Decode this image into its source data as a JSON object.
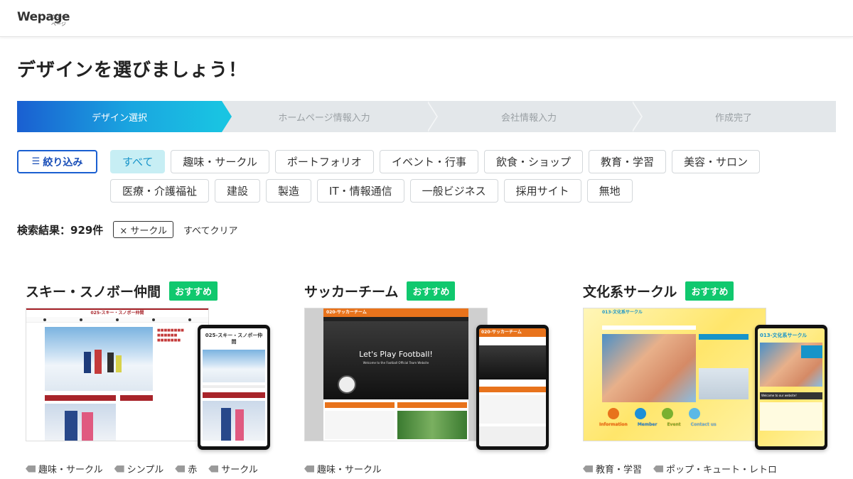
{
  "header": {
    "logo": "Wepage",
    "logo_ruby": "ウィーページ"
  },
  "page_title": "デザインを選びましょう！",
  "steps": [
    {
      "label": "デザイン選択",
      "active": true
    },
    {
      "label": "ホームページ情報入力",
      "active": false
    },
    {
      "label": "会社情報入力",
      "active": false
    },
    {
      "label": "作成完了",
      "active": false
    }
  ],
  "filter": {
    "label": "絞り込み",
    "icon": "filter-search-icon"
  },
  "chips": [
    {
      "label": "すべて",
      "active": true
    },
    {
      "label": "趣味・サークル"
    },
    {
      "label": "ポートフォリオ"
    },
    {
      "label": "イベント・行事"
    },
    {
      "label": "飲食・ショップ"
    },
    {
      "label": "教育・学習"
    },
    {
      "label": "美容・サロン"
    },
    {
      "label": "医療・介護福祉"
    },
    {
      "label": "建設"
    },
    {
      "label": "製造"
    },
    {
      "label": "IT・情報通信"
    },
    {
      "label": "一般ビジネス"
    },
    {
      "label": "採用サイト"
    },
    {
      "label": "無地"
    }
  ],
  "results": {
    "label": "検索結果：929件",
    "active_tag": "× サークル",
    "clear": "すべてクリア"
  },
  "colors": {
    "accent": "#1a5fd1",
    "badge": "#10c86e",
    "chip_active_bg": "#c7eef4"
  },
  "cards": [
    {
      "title": "スキー・スノボー仲間",
      "badge": "おすすめ",
      "desk_heading": "025-スキー・スノボー仲間",
      "phone_heading": "025-スキー・スノボー仲間",
      "tags": [
        "趣味・サークル",
        "シンプル",
        "赤",
        "サークル"
      ]
    },
    {
      "title": "サッカーチーム",
      "badge": "おすすめ",
      "desk_heading": "020-サッカーチーム",
      "desk_hero": "Let's Play Football!",
      "desk_sub": "Welcome to the Football Official Team Website",
      "phone_heading": "020-サッカーチーム",
      "tags": [
        "趣味・サークル"
      ]
    },
    {
      "title": "文化系サークル",
      "badge": "おすすめ",
      "desk_heading": "013-文化系サークル",
      "phone_heading": "013-文化系サークル",
      "phone_welcome": "Welcome to our website!",
      "icons": [
        "Information",
        "Member",
        "Event",
        "Contact us"
      ],
      "tags": [
        "教育・学習",
        "ポップ・キュート・レトロ"
      ]
    }
  ]
}
